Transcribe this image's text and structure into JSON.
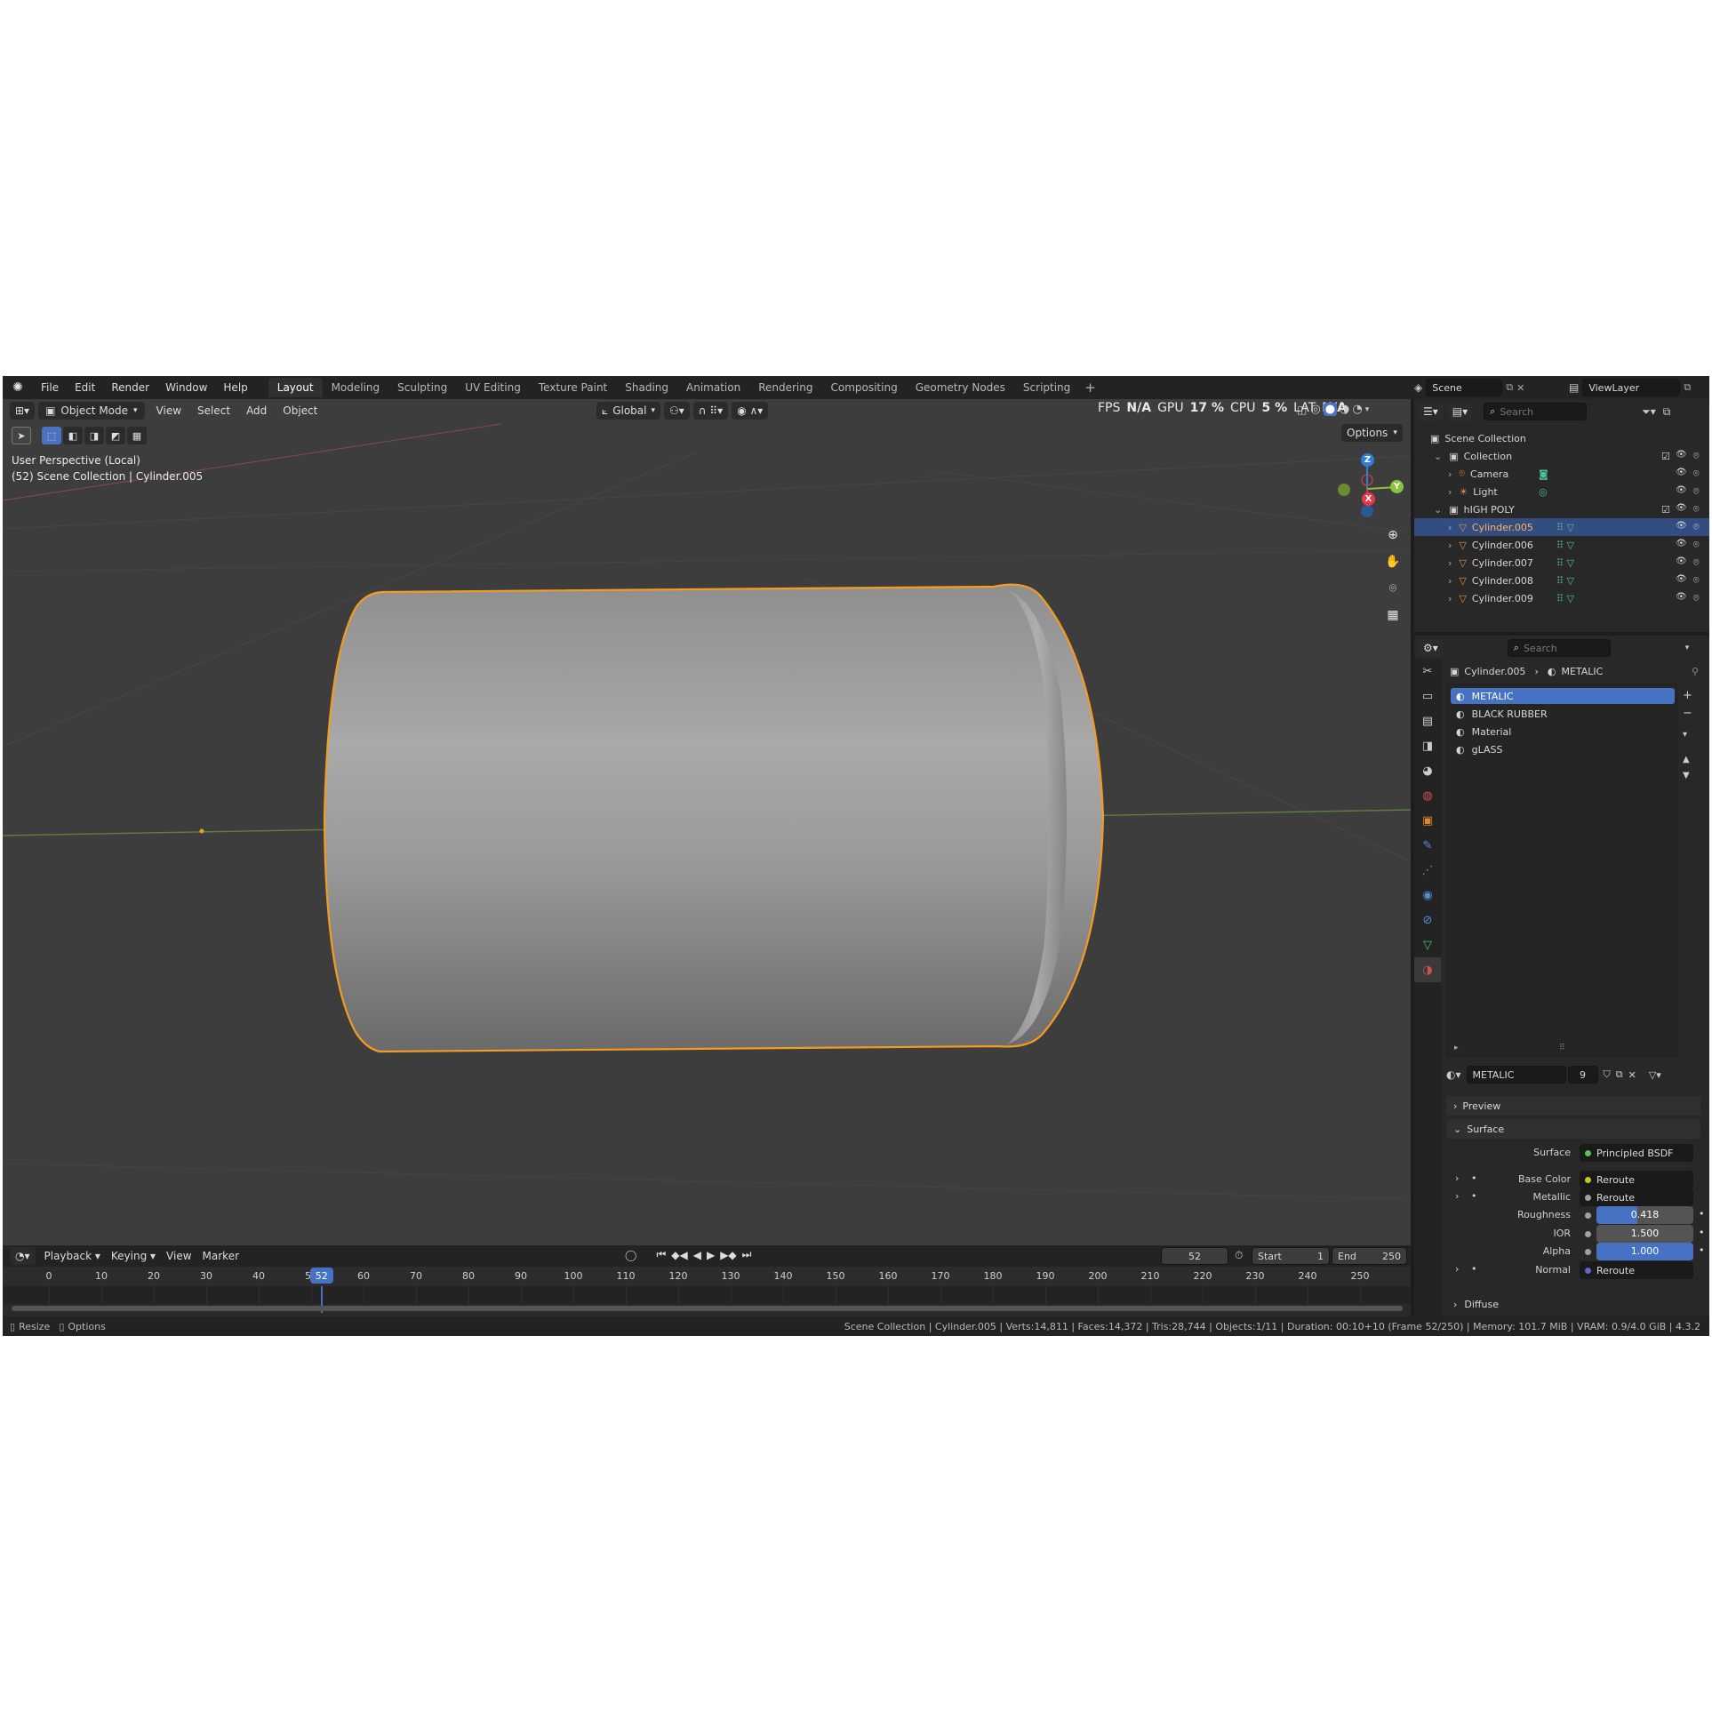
{
  "topbar": {
    "menus": [
      "File",
      "Edit",
      "Render",
      "Window",
      "Help"
    ],
    "workspaces": [
      "Layout",
      "Modeling",
      "Sculpting",
      "UV Editing",
      "Texture Paint",
      "Shading",
      "Animation",
      "Rendering",
      "Compositing",
      "Geometry Nodes",
      "Scripting"
    ],
    "active_workspace": "Layout",
    "scene": "Scene",
    "view_layer": "ViewLayer"
  },
  "viewport": {
    "mode": "Object Mode",
    "menus": [
      "View",
      "Select",
      "Add",
      "Object"
    ],
    "transform_orientation": "Global",
    "options_label": "Options",
    "perf": {
      "fps_label": "FPS",
      "fps_value": "N/A",
      "gpu_label": "GPU",
      "gpu_value": "17 %",
      "cpu_label": "CPU",
      "cpu_value": "5 %",
      "lat_label": "LAT",
      "lat_value": "N/A"
    },
    "info_line1": "User Perspective (Local)",
    "info_line2": "(52) Scene Collection | Cylinder.005",
    "gizmo": {
      "x": "X",
      "y": "Y",
      "z": "Z"
    },
    "colors": {
      "outline": "#f5a623",
      "x_axis": "#e8374b",
      "y_axis": "#8ac43f",
      "z_axis": "#2f7dd4"
    }
  },
  "timeline": {
    "menus": [
      "Playback",
      "Keying",
      "View",
      "Marker"
    ],
    "current_frame": "52",
    "start_label": "Start",
    "start_value": "1",
    "end_label": "End",
    "end_value": "250",
    "ticks": [
      "0",
      "10",
      "20",
      "30",
      "40",
      "50",
      "60",
      "70",
      "80",
      "90",
      "100",
      "110",
      "120",
      "130",
      "140",
      "150",
      "160",
      "170",
      "180",
      "190",
      "200",
      "210",
      "220",
      "230",
      "240",
      "250"
    ]
  },
  "statusbar": {
    "left1": "Resize",
    "left2": "Options",
    "right": "Scene Collection | Cylinder.005 | Verts:14,811 | Faces:14,372 | Tris:28,744 | Objects:1/11 | Duration: 00:10+10 (Frame 52/250) | Memory: 101.7 MiB | VRAM: 0.9/4.0 GiB | 4.3.2"
  },
  "outliner": {
    "search_placeholder": "Search",
    "scene_collection": "Scene Collection",
    "items": [
      {
        "label": "Collection",
        "level": 1,
        "type": "collection"
      },
      {
        "label": "Camera",
        "level": 2,
        "type": "camera"
      },
      {
        "label": "Light",
        "level": 2,
        "type": "light"
      },
      {
        "label": "hIGH POLY",
        "level": 1,
        "type": "collection"
      },
      {
        "label": "Cylinder.005",
        "level": 2,
        "type": "mesh",
        "selected": true
      },
      {
        "label": "Cylinder.006",
        "level": 2,
        "type": "mesh"
      },
      {
        "label": "Cylinder.007",
        "level": 2,
        "type": "mesh"
      },
      {
        "label": "Cylinder.008",
        "level": 2,
        "type": "mesh"
      },
      {
        "label": "Cylinder.009",
        "level": 2,
        "type": "mesh"
      }
    ]
  },
  "properties": {
    "search_placeholder": "Search",
    "breadcrumb_object": "Cylinder.005",
    "breadcrumb_material": "METALIC",
    "materials": [
      "METALIC",
      "BLACK RUBBER",
      "Material",
      "gLASS"
    ],
    "active_material": "METALIC",
    "user_count": "9",
    "panel_preview": "Preview",
    "panel_surface": "Surface",
    "panel_diffuse": "Diffuse",
    "sockets": [
      {
        "label": "Surface",
        "value": "Principled BSDF",
        "kind": "link",
        "dot": "#5bbf5b"
      },
      {
        "label": "Base Color",
        "value": "Reroute",
        "kind": "link",
        "dot": "#c7c729"
      },
      {
        "label": "Metallic",
        "value": "Reroute",
        "kind": "link",
        "dot": "#a1a1a1"
      },
      {
        "label": "Roughness",
        "value": "0.418",
        "kind": "slider",
        "fraction": 0.418,
        "dot": "#a1a1a1"
      },
      {
        "label": "IOR",
        "value": "1.500",
        "kind": "num",
        "dot": "#a1a1a1"
      },
      {
        "label": "Alpha",
        "value": "1.000",
        "kind": "slider",
        "fraction": 1.0,
        "dot": "#a1a1a1"
      },
      {
        "label": "Normal",
        "value": "Reroute",
        "kind": "link",
        "dot": "#6363c7"
      }
    ]
  }
}
